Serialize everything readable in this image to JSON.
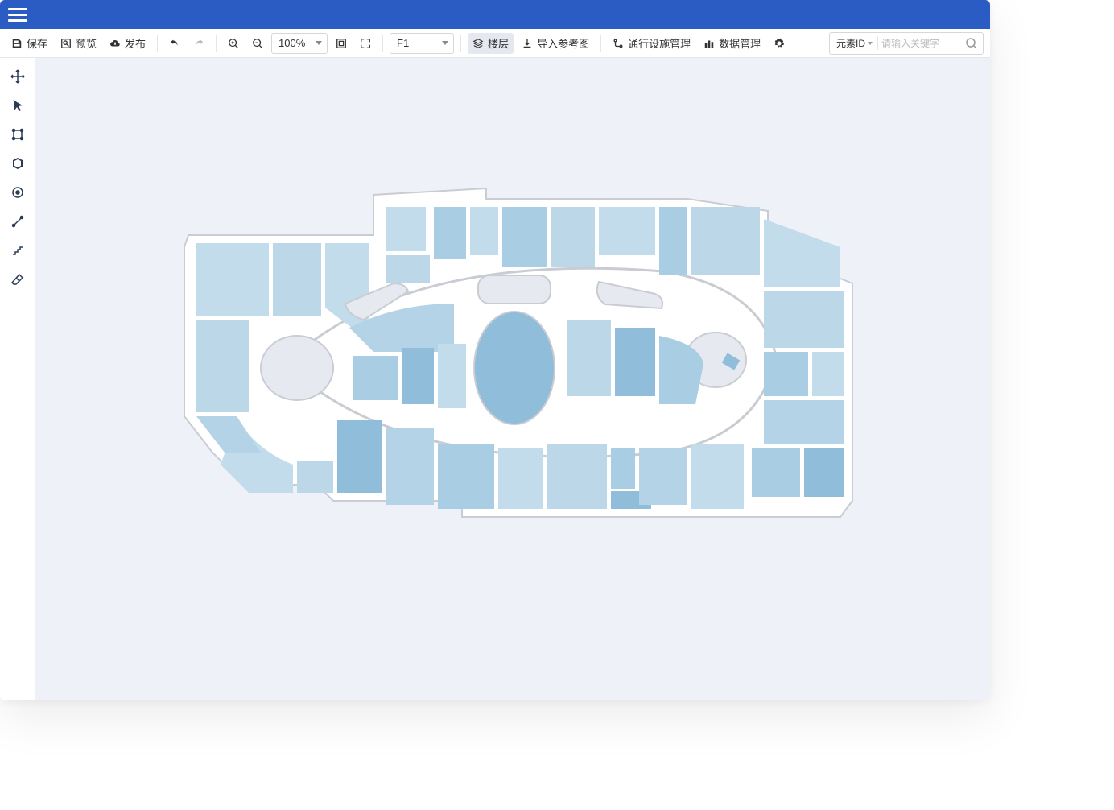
{
  "toolbar": {
    "save": "保存",
    "preview": "预览",
    "publish": "发布",
    "zoom_value": "100%",
    "floor_select": "F1",
    "floors_btn": "楼层",
    "import_ref": "导入参考图",
    "passage_mgmt": "通行设施管理",
    "data_mgmt": "数据管理"
  },
  "search": {
    "type_label": "元素ID",
    "placeholder": "请输入关键字"
  },
  "colors": {
    "brand": "#2b5cc4",
    "canvas_bg": "#eef1f8",
    "shape_light": "#c3dceb",
    "shape_mid": "#a9cde3",
    "shape_dark": "#8fbdda",
    "shape_darker": "#7bb0d2",
    "outline": "#c9ccd2",
    "atrium": "#e6e9f0"
  }
}
